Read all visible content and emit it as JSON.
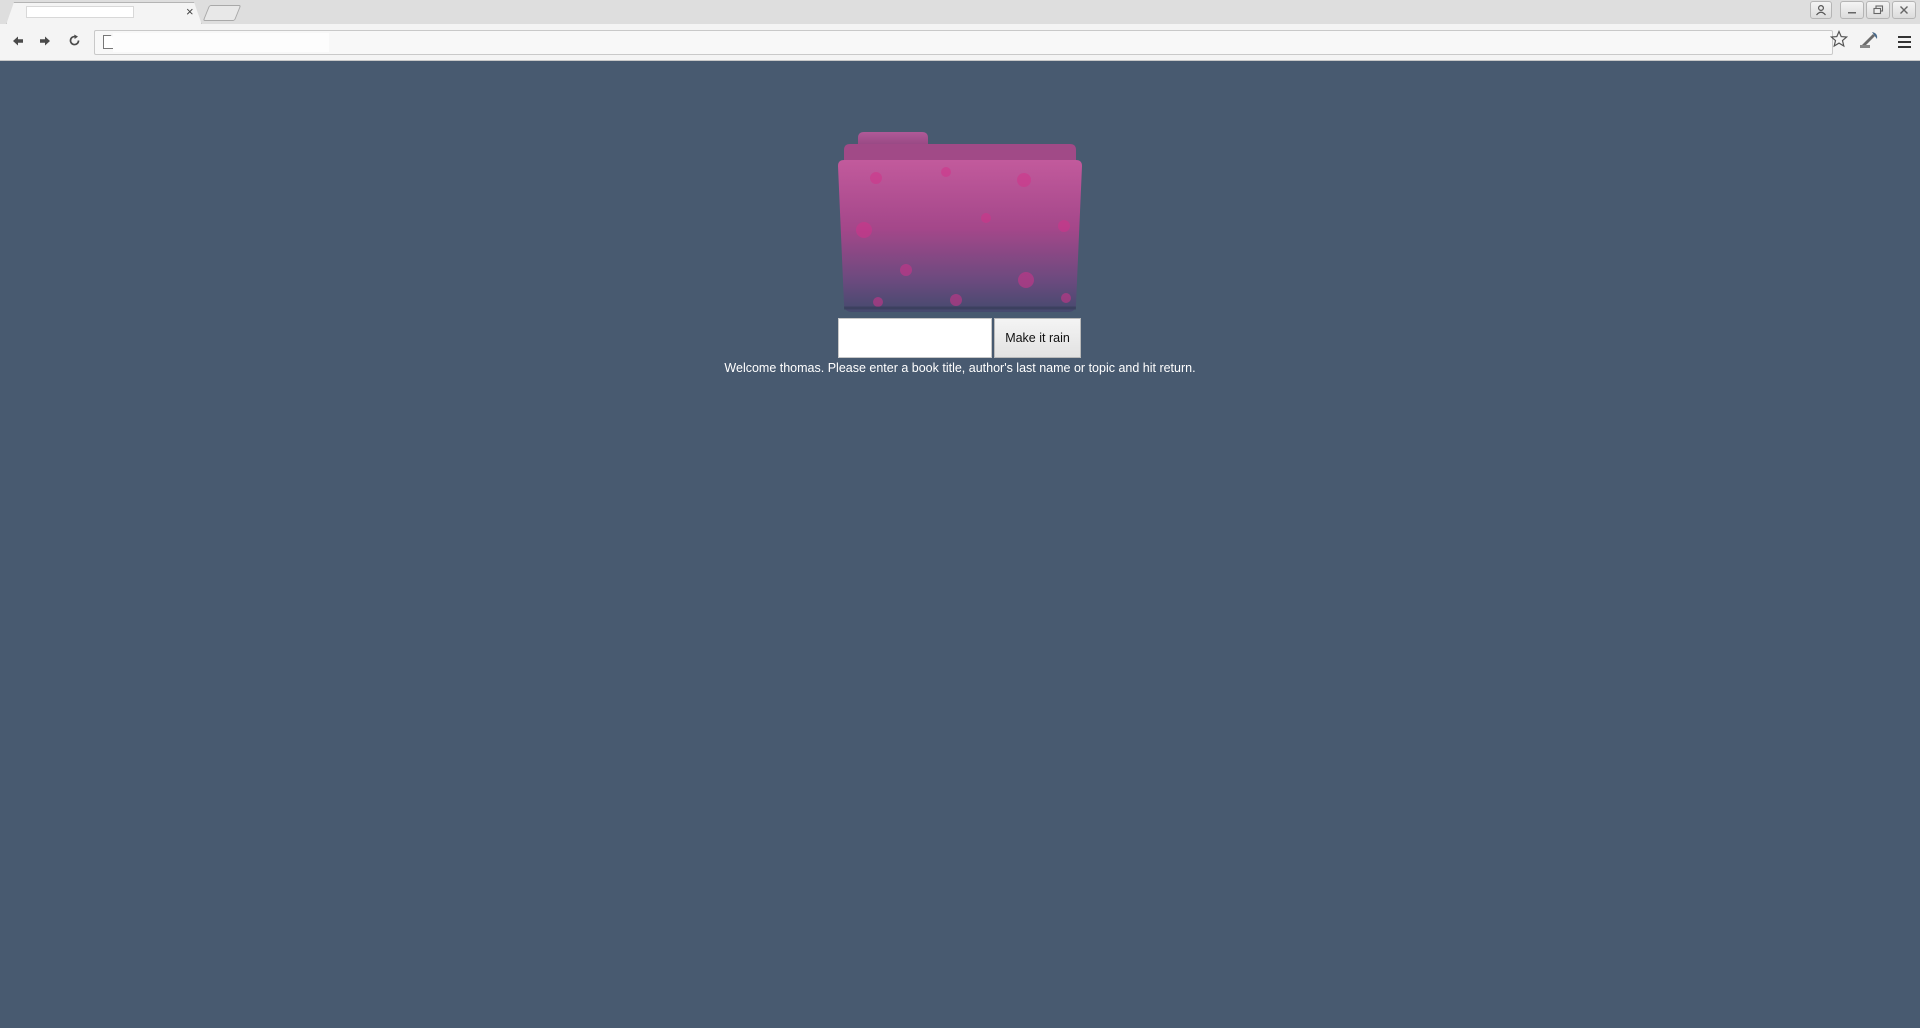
{
  "browser": {
    "tab_title": "",
    "tab_close": "×",
    "address": ""
  },
  "icons": {
    "back": "back-arrow-icon",
    "forward": "forward-arrow-icon",
    "reload": "reload-icon",
    "page": "page-icon",
    "star": "star-icon",
    "extension": "extension-icon",
    "menu": "menu-icon",
    "folder": "pink-floral-folder-icon"
  },
  "search": {
    "input_value": "",
    "button_label": "Make it rain"
  },
  "message": {
    "welcome": "Welcome thomas. Please enter a book title, author's last name or topic and hit return."
  },
  "colors": {
    "page_background": "#485a70",
    "folder_pink": "#b04a8c",
    "folder_dark": "#4a4f73"
  }
}
